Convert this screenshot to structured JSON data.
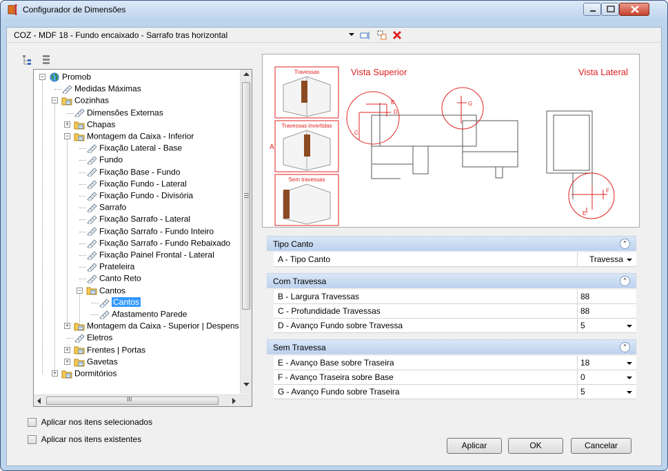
{
  "window": {
    "title": "Configurador de Dimensões"
  },
  "toolbar": {
    "selected_item": "COZ - MDF 18 - Fundo encaixado - Sarrafo tras horizontal"
  },
  "tree": {
    "items": [
      {
        "label": "Promob"
      },
      {
        "label": "Medidas Máximas"
      },
      {
        "label": "Cozinhas"
      },
      {
        "label": "Dimensões Externas"
      },
      {
        "label": "Chapas"
      },
      {
        "label": "Montagem da Caixa - Inferior"
      },
      {
        "label": "Fixação Lateral - Base"
      },
      {
        "label": "Fundo"
      },
      {
        "label": "Fixação Base - Fundo"
      },
      {
        "label": "Fixação Fundo - Lateral"
      },
      {
        "label": "Fixação Fundo - Divisória"
      },
      {
        "label": "Sarrafo"
      },
      {
        "label": "Fixação Sarrafo - Lateral"
      },
      {
        "label": "Fixação Sarrafo - Fundo Inteiro"
      },
      {
        "label": "Fixação Sarrafo - Fundo Rebaixado"
      },
      {
        "label": "Fixação Painel Frontal - Lateral"
      },
      {
        "label": "Prateleira"
      },
      {
        "label": "Canto Reto"
      },
      {
        "label": "Cantos"
      },
      {
        "label": "Cantos"
      },
      {
        "label": "Afastamento Parede"
      },
      {
        "label": "Montagem da Caixa - Superior | Despens"
      },
      {
        "label": "Eletros"
      },
      {
        "label": "Frentes | Portas"
      },
      {
        "label": "Gavetas"
      },
      {
        "label": "Dormitórios"
      }
    ],
    "hscroll_glyph": "III"
  },
  "checkboxes": {
    "apply_selected": "Aplicar nos itens selecionados",
    "apply_existing": "Aplicar nos itens existentes"
  },
  "preview": {
    "travessas": "Travessas",
    "travessas_invertidas": "Travessas invertidas",
    "sem_travessas": "Sem travessas",
    "side_label": "A",
    "vista_superior": "Vista Superior",
    "vista_lateral": "Vista Lateral",
    "dims": {
      "b": "B",
      "c": "C",
      "d": "D",
      "e": "E",
      "f": "F",
      "g": "G"
    }
  },
  "properties": {
    "cat1": {
      "label": "Tipo Canto",
      "rows": [
        {
          "name": "A - Tipo Canto",
          "value": "Travessa"
        }
      ]
    },
    "cat2": {
      "label": "Com Travessa",
      "rows": [
        {
          "name": "B - Largura Travessas",
          "value": "88"
        },
        {
          "name": "C - Profundidade Travessas",
          "value": "88"
        },
        {
          "name": "D - Avanço Fundo sobre Travessa",
          "value": "5"
        }
      ]
    },
    "cat3": {
      "label": "Sem Travessa",
      "rows": [
        {
          "name": "E - Avanço Base sobre Traseira",
          "value": "18"
        },
        {
          "name": "F - Avanço Traseira sobre Base",
          "value": "0"
        },
        {
          "name": "G - Avanço Fundo sobre Traseira",
          "value": "5"
        }
      ]
    }
  },
  "buttons": {
    "apply": "Aplicar",
    "ok": "OK",
    "cancel": "Cancelar"
  },
  "colors": {
    "accent": "#3399ff",
    "diagram_red": "#e02020",
    "wood": "#8b4a22"
  }
}
